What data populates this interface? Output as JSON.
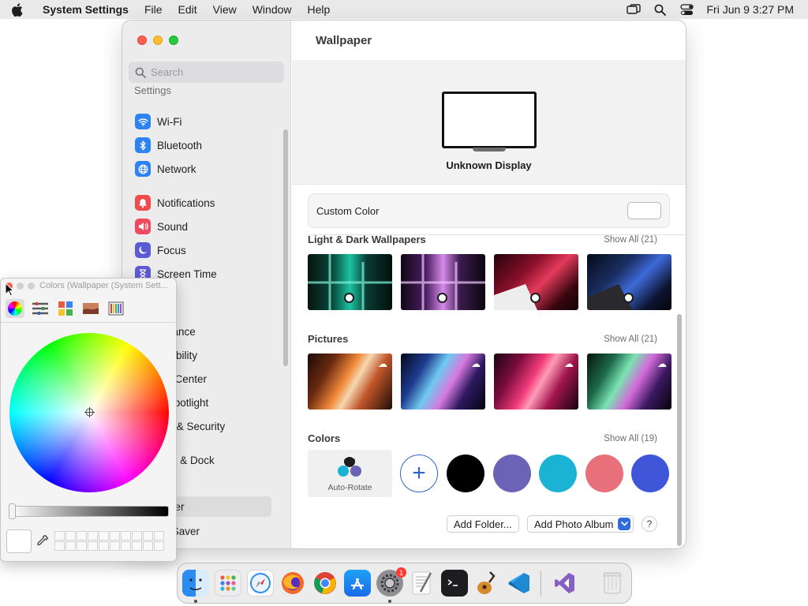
{
  "menubar": {
    "app_name": "System Settings",
    "menus": [
      "File",
      "Edit",
      "View",
      "Window",
      "Help"
    ],
    "clock": "Fri Jun 9  3:27 PM"
  },
  "sidebar": {
    "search_placeholder": "Search",
    "cut_label": "Settings",
    "items": [
      {
        "label": "Wi-Fi",
        "icon": "wifi-icon",
        "color": "#2e83f4"
      },
      {
        "label": "Bluetooth",
        "icon": "bluetooth-icon",
        "color": "#2e83f4"
      },
      {
        "label": "Network",
        "icon": "globe-icon",
        "color": "#2e83f4"
      },
      {
        "label": "Notifications",
        "icon": "bell-icon",
        "color": "#ef4b4b"
      },
      {
        "label": "Sound",
        "icon": "speaker-icon",
        "color": "#ef4b5f"
      },
      {
        "label": "Focus",
        "icon": "moon-icon",
        "color": "#5d5bd4"
      },
      {
        "label": "Screen Time",
        "icon": "hourglass-icon",
        "color": "#5d5bd4"
      },
      {
        "label": "eral"
      },
      {
        "label": "earance"
      },
      {
        "label": "essibility"
      },
      {
        "label": "trol Center"
      },
      {
        "label": "& Spotlight"
      },
      {
        "label": "acy & Security"
      },
      {
        "label": "ktop & Dock"
      },
      {
        "label": "lays"
      },
      {
        "label": "paper",
        "selected": true
      },
      {
        "label": "en Saver"
      }
    ]
  },
  "content": {
    "title": "Wallpaper",
    "display_name": "Unknown Display",
    "custom_color_label": "Custom Color",
    "sections": {
      "light_dark": {
        "title": "Light & Dark Wallpapers",
        "show_all": "Show All (21)"
      },
      "pictures": {
        "title": "Pictures",
        "show_all": "Show All (21)"
      },
      "colors": {
        "title": "Colors",
        "show_all": "Show All (19)"
      }
    },
    "auto_rotate_label": "Auto-Rotate",
    "color_swatches": [
      "#000000",
      "#6b63b5",
      "#1bb3d4",
      "#e8707a",
      "#3f56d9"
    ],
    "buttons": {
      "add_folder": "Add Folder...",
      "add_photo_album": "Add Photo Album",
      "help": "?"
    }
  },
  "colors_panel": {
    "title": "Colors (Wallpaper (System Sett..."
  },
  "dock": {
    "apps": [
      "finder-icon",
      "launchpad-icon",
      "safari-icon",
      "firefox-icon",
      "chrome-icon",
      "app-store-icon",
      "system-settings-icon",
      "textedit-icon",
      "terminal-icon",
      "garageband-icon",
      "vscode-icon",
      "visual-studio-icon",
      "trash-icon"
    ],
    "settings_badge": "1"
  }
}
